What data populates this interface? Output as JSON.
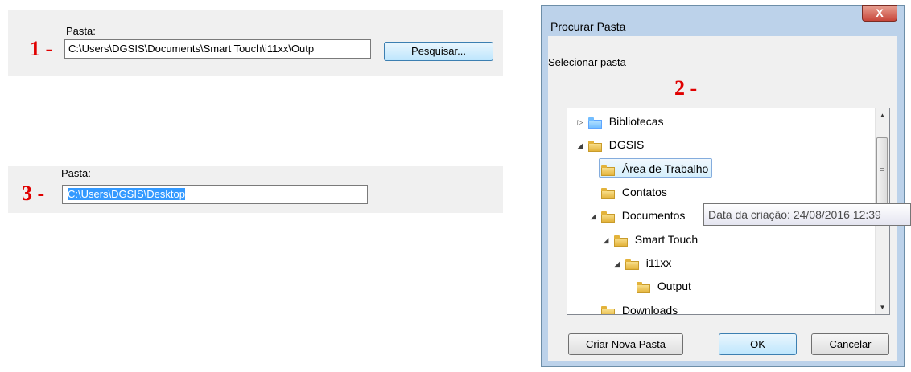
{
  "panel1": {
    "marker": "1 -",
    "label": "Pasta:",
    "path_value": "C:\\Users\\DGSIS\\Documents\\Smart Touch\\i11xx\\Outp",
    "search_button": "Pesquisar..."
  },
  "panel3": {
    "marker": "3 -",
    "label": "Pasta:",
    "path_value": "C:\\Users\\DGSIS\\Desktop"
  },
  "dialog": {
    "title": "Procurar Pasta",
    "close_glyph": "X",
    "subtitle": "Selecionar pasta",
    "marker": "2 -",
    "tree": [
      {
        "label": "Bibliotecas",
        "expander": "▷",
        "icon": "libraries-icon",
        "level": 0
      },
      {
        "label": "DGSIS",
        "expander": "◢",
        "icon": "user-folder-icon",
        "level": 0
      },
      {
        "label": "Área de Trabalho",
        "expander": "",
        "icon": "desktop-icon",
        "level": 1,
        "selected": true
      },
      {
        "label": "Contatos",
        "expander": "",
        "icon": "contacts-icon",
        "level": 1
      },
      {
        "label": "Documentos",
        "expander": "◢",
        "icon": "documents-icon",
        "level": 1
      },
      {
        "label": "Smart Touch",
        "expander": "◢",
        "icon": "folder-icon",
        "level": 2
      },
      {
        "label": "i11xx",
        "expander": "◢",
        "icon": "folder-icon",
        "level": 3
      },
      {
        "label": "Output",
        "expander": "",
        "icon": "folder-icon",
        "level": 4
      },
      {
        "label": "Downloads",
        "expander": "",
        "icon": "downloads-icon",
        "level": 1
      }
    ],
    "tooltip": "Data da criação: 24/08/2016 12:39",
    "buttons": {
      "new_folder": "Criar Nova Pasta",
      "ok": "OK",
      "cancel": "Cancelar"
    }
  },
  "colors": {
    "marker": "#e00000",
    "selection": "#3399ff",
    "dialog_frame": "#bcd2ea",
    "close_button": "#c7463a"
  }
}
